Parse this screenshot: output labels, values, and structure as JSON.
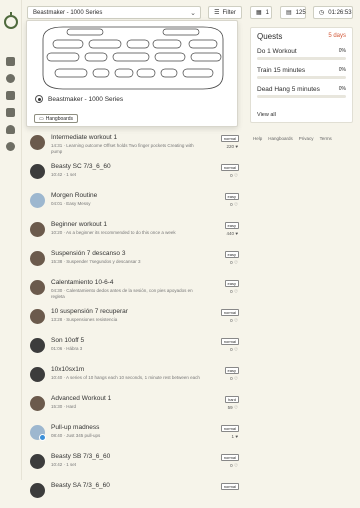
{
  "topbar": {
    "selected_board": "Beastmaker - 1000 Series",
    "filter_label": "Filter",
    "chip_1": "1",
    "chip_2": "125",
    "timer": "01:26:53"
  },
  "dropdown": {
    "board_option": "Beastmaker - 1000 Series",
    "hangboards_button": "Hangboards"
  },
  "quests": {
    "title": "Quests",
    "days": "5 days",
    "items": [
      {
        "name": "Do 1 Workout",
        "pct": "0%"
      },
      {
        "name": "Train 15 minutes",
        "pct": "0%"
      },
      {
        "name": "Dead Hang 5 minutes",
        "pct": "0%"
      }
    ],
    "view_all": "View all"
  },
  "footer": [
    "Help",
    "Hangboards",
    "Privacy",
    "Terms"
  ],
  "workouts": [
    {
      "name": "Intermediate workout 1",
      "desc": "14:31 · Learning outcome Offset holds Two finger pockets Creating with pump",
      "grade": "normal",
      "likes": "220"
    },
    {
      "name": "Beasty SC 7/3_6_60",
      "desc": "10:42 · 1 set",
      "grade": "normal",
      "likes": "0"
    },
    {
      "name": "Morgen Routine",
      "desc": "04:01 · Easy Messy",
      "grade": "easy",
      "likes": "0"
    },
    {
      "name": "Beginner workout 1",
      "desc": "10:20 · As a beginner its recommended to do this once a week",
      "grade": "easy",
      "likes": "440"
    },
    {
      "name": "Suspensión 7 descanso 3",
      "desc": "15:38 · Suspender 7segundos y descansar 3",
      "grade": "easy",
      "likes": "0"
    },
    {
      "name": "Calentamiento 10-6-4",
      "desc": "04:30 · Calentamiento dedos antes de la sesión, con pies apoyados en regleta",
      "grade": "easy",
      "likes": "0"
    },
    {
      "name": "10 suspensión 7 recuperar",
      "desc": "13:28 · Suspensiones resistencia",
      "grade": "normal",
      "likes": "0"
    },
    {
      "name": "Son 10off 5",
      "desc": "01:06 · Hábra 3",
      "grade": "normal",
      "likes": "0"
    },
    {
      "name": "10x10sx1m",
      "desc": "10:40 · A series of 10 hangs each 10 seconds, 1 minute rest between each",
      "grade": "easy",
      "likes": "0"
    },
    {
      "name": "Advanced Workout 1",
      "desc": "15:30 · Hard",
      "grade": "hard",
      "likes": "59"
    },
    {
      "name": "Pull-up madness",
      "desc": "08:40 · Just 345 pull-ups",
      "grade": "normal",
      "likes": "1"
    },
    {
      "name": "Beasty SB 7/3_6_60",
      "desc": "10:42 · 1 set",
      "grade": "normal",
      "likes": "0"
    },
    {
      "name": "Beasty SA 7/3_6_60",
      "desc": "",
      "grade": "normal",
      "likes": ""
    }
  ],
  "colors": {
    "accent": "#4f6a3d",
    "days": "#d35a3a",
    "background": "#f6f4ea"
  }
}
